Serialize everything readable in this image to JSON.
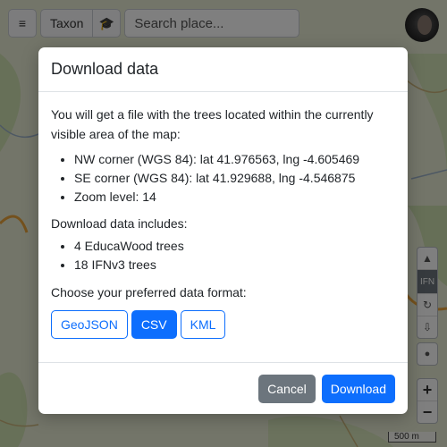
{
  "toolbar": {
    "taxon_label": "Taxon",
    "search_placeholder": "Search place..."
  },
  "map_controls": {
    "ifn_label": "IFN",
    "scale_label": "500 m",
    "zoom_in_label": "+",
    "zoom_out_label": "−"
  },
  "modal": {
    "title": "Download data",
    "intro": "You will get a file with the trees located within the currently visible area of the map:",
    "area_items": [
      "NW corner (WGS 84): lat 41.976563, lng -4.605469",
      "SE corner (WGS 84): lat 41.929688, lng -4.546875",
      "Zoom level: 14"
    ],
    "includes_label": "Download data includes:",
    "includes_items": [
      "4 EducaWood trees",
      "18 IFNv3 trees"
    ],
    "format_label": "Choose your preferred data format:",
    "formats": [
      "GeoJSON",
      "CSV",
      "KML"
    ],
    "selected_format": "CSV",
    "cancel_label": "Cancel",
    "download_label": "Download"
  },
  "colors": {
    "primary": "#0d6efd",
    "secondary": "#6c757d"
  }
}
